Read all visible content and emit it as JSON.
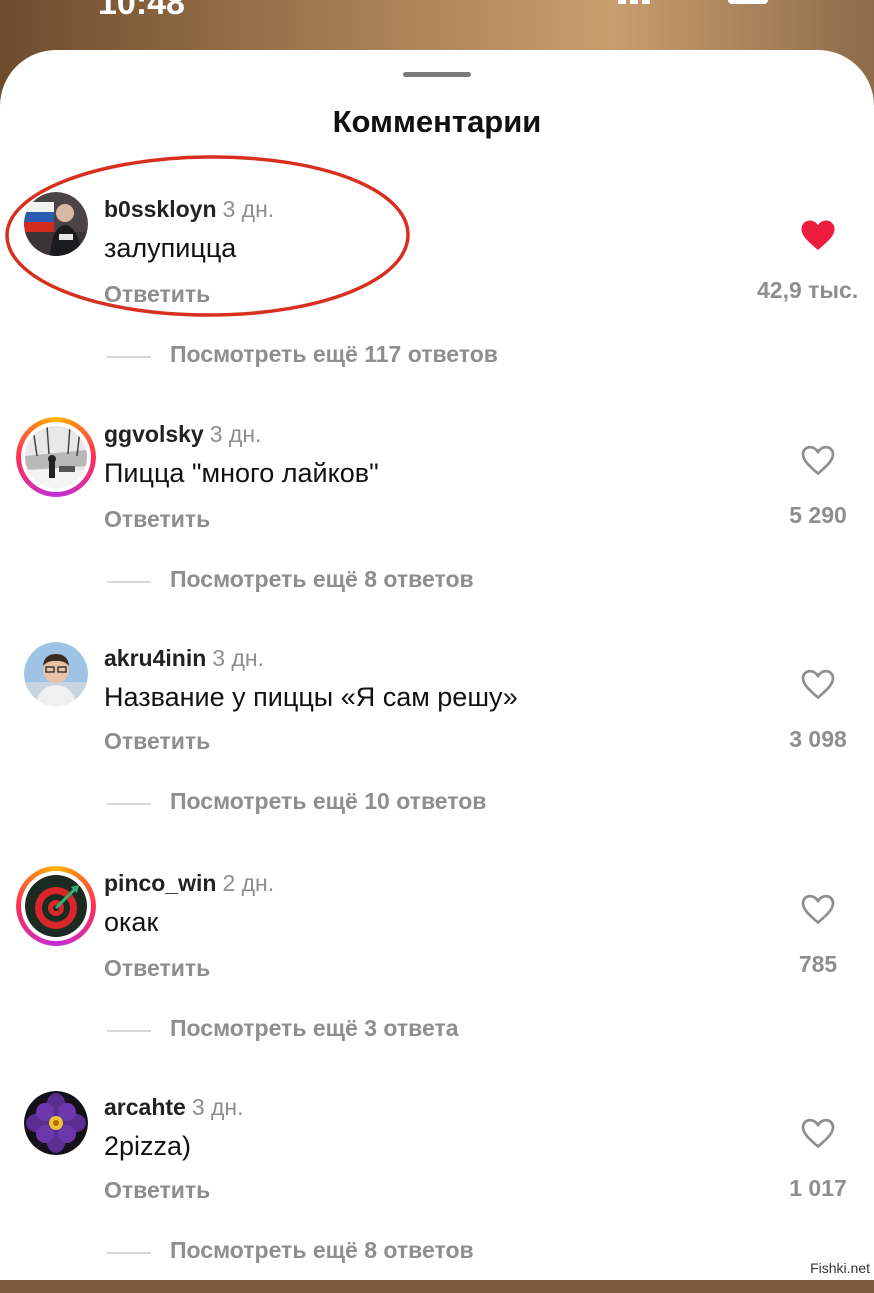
{
  "status_bar": {
    "time": "10:48"
  },
  "sheet": {
    "title": "Комментарии"
  },
  "comments": [
    {
      "username": "b0sskloyn",
      "age": "3 дн.",
      "text": "залупицца",
      "reply_label": "Ответить",
      "likes": "42,9 тыс.",
      "liked": true,
      "view_replies": "Посмотреть ещё 117 ответов",
      "avatar": "photo-flag"
    },
    {
      "username": "ggvolsky",
      "age": "3 дн.",
      "text": "Пицца \"много лайков\"",
      "reply_label": "Ответить",
      "likes": "5 290",
      "liked": false,
      "view_replies": "Посмотреть ещё 8 ответов",
      "avatar": "photo-street-story"
    },
    {
      "username": "akru4inin",
      "age": "3 дн.",
      "text": "Название у пиццы «Я сам решу»",
      "reply_label": "Ответить",
      "likes": "3 098",
      "liked": false,
      "view_replies": "Посмотреть ещё 10 ответов",
      "avatar": "photo-person"
    },
    {
      "username": "pinco_win",
      "age": "2 дн.",
      "text": "окак",
      "reply_label": "Ответить",
      "likes": "785",
      "liked": false,
      "view_replies": "Посмотреть ещё 3 ответа",
      "avatar": "target-logo-story"
    },
    {
      "username": "arcahte",
      "age": "3 дн.",
      "text": "2pizza)",
      "reply_label": "Ответить",
      "likes": "1 017",
      "liked": false,
      "view_replies": "Посмотреть ещё 8 ответов",
      "avatar": "purple-flower"
    }
  ],
  "watermark": "Fishki.net",
  "colors": {
    "liked_heart": "#ee1d3f",
    "annotation_circle": "#d8301e",
    "secondary_text": "#8e8e8e"
  }
}
